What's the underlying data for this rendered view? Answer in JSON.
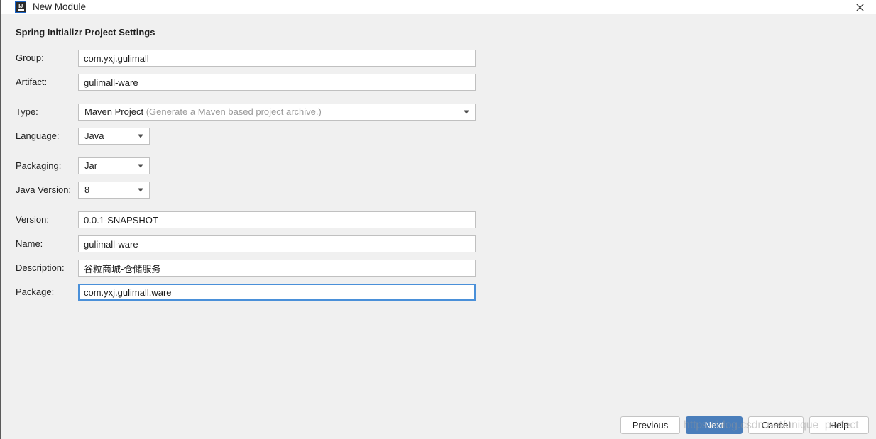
{
  "window": {
    "title": "New Module",
    "icon": "intellij-idea-icon",
    "close_icon": "close-icon",
    "accent_color": "#4a7ebb",
    "focus_color": "#4a90d9",
    "background_color": "#f0f0f0",
    "titlebar_color": "#ffffff"
  },
  "section": {
    "title": "Spring Initializr Project Settings"
  },
  "fields": {
    "group": {
      "label": "Group:",
      "value": "com.yxj.gulimall",
      "type": "text"
    },
    "artifact": {
      "label": "Artifact:",
      "value": "gulimall-ware",
      "type": "text"
    },
    "type": {
      "label": "Type:",
      "value": "Maven Project",
      "hint": "(Generate a Maven based project archive.)",
      "type": "combo"
    },
    "language": {
      "label": "Language:",
      "value": "Java",
      "type": "combo"
    },
    "packaging": {
      "label": "Packaging:",
      "value": "Jar",
      "type": "combo"
    },
    "java_version": {
      "label": "Java Version:",
      "value": "8",
      "type": "combo"
    },
    "version": {
      "label": "Version:",
      "value": "0.0.1-SNAPSHOT",
      "type": "text"
    },
    "name": {
      "label": "Name:",
      "value": "gulimall-ware",
      "type": "text"
    },
    "description": {
      "label": "Description:",
      "value": "谷粒商城-仓储服务",
      "type": "text"
    },
    "package": {
      "label": "Package:",
      "value": "com.yxj.gulimall.ware",
      "type": "text",
      "focused": true
    }
  },
  "buttons": {
    "previous": "Previous",
    "next": "Next",
    "cancel": "Cancel",
    "help": "Help"
  },
  "watermark": {
    "text": "https://blog.csdn.net/unique_perfect"
  }
}
